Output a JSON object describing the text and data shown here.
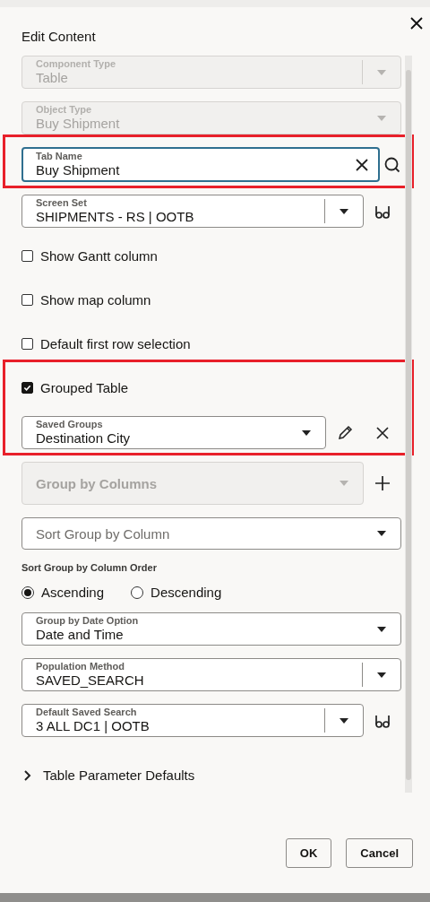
{
  "title": "Edit Content",
  "form": [
    {
      "kind": "select",
      "label": "Component Type",
      "value": "Table",
      "disabled": true,
      "divider": true
    },
    {
      "kind": "select",
      "label": "Object Type",
      "value": "Buy Shipment",
      "disabled": true
    },
    {
      "kind": "highlight",
      "children": [
        {
          "kind": "text",
          "label": "Tab Name",
          "value": "Buy Shipment",
          "focused": true,
          "clear": true,
          "actions": [
            {
              "kind": "search"
            }
          ]
        }
      ]
    },
    {
      "kind": "select",
      "label": "Screen Set",
      "value": "SHIPMENTS - RS | OOTB",
      "divider": true,
      "actions": [
        {
          "kind": "glasses"
        }
      ]
    },
    {
      "kind": "checkbox",
      "label": "Show Gantt column",
      "checked": false
    },
    {
      "kind": "checkbox",
      "label": "Show map column",
      "checked": false
    },
    {
      "kind": "checkbox",
      "label": "Default first row selection",
      "checked": false
    },
    {
      "kind": "highlight",
      "children": [
        {
          "kind": "checkbox",
          "label": "Grouped Table",
          "checked": true
        },
        {
          "kind": "select",
          "label": "Saved Groups",
          "value": "Destination City",
          "actions": [
            {
              "kind": "pencil"
            },
            {
              "kind": "close"
            }
          ]
        }
      ]
    },
    {
      "kind": "select",
      "placeholder": "Group by Columns",
      "disabled": true,
      "actions": [
        {
          "kind": "plus"
        }
      ]
    },
    {
      "kind": "select",
      "placeholder": "Sort Group by Column"
    },
    {
      "kind": "radio-group",
      "label": "Sort Group by Column Order",
      "options": [
        {
          "label": "Ascending",
          "selected": true
        },
        {
          "label": "Descending",
          "selected": false
        }
      ]
    },
    {
      "kind": "select",
      "label": "Group by Date Option",
      "value": "Date and Time"
    },
    {
      "kind": "select",
      "label": "Population Method",
      "value": "SAVED_SEARCH",
      "divider": true
    },
    {
      "kind": "select",
      "label": "Default Saved Search",
      "value": "3 ALL DC1 | OOTB",
      "divider": true,
      "actions": [
        {
          "kind": "glasses"
        }
      ]
    },
    {
      "kind": "section",
      "label": "Table Parameter Defaults",
      "expanded": false
    }
  ],
  "buttons": [
    {
      "label": "OK"
    },
    {
      "label": "Cancel"
    }
  ]
}
